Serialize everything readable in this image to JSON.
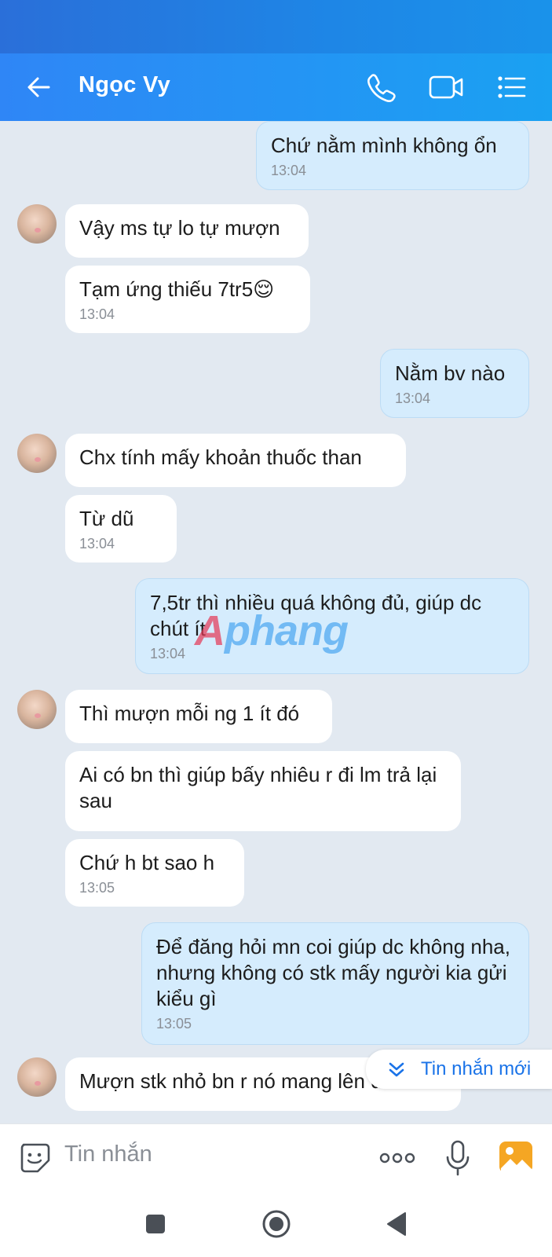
{
  "header": {
    "title": "Ngọc Vy",
    "back_icon": "arrow-left-icon",
    "call_icon": "phone-icon",
    "video_icon": "video-camera-icon",
    "menu_icon": "list-menu-icon"
  },
  "messages": [
    {
      "direction": "out",
      "text": "Chứ nằm mình không ổn",
      "time": "13:04"
    },
    {
      "direction": "in",
      "text": "Vậy ms tự lo tự mượn",
      "time": ""
    },
    {
      "direction": "in",
      "text": "Tạm ứng thiếu 7tr5😌",
      "time": "13:04"
    },
    {
      "direction": "out",
      "text": "Nằm bv nào",
      "time": "13:04"
    },
    {
      "direction": "in",
      "text": "Chx tính mấy khoản thuốc than",
      "time": ""
    },
    {
      "direction": "in",
      "text": "Từ dũ",
      "time": "13:04"
    },
    {
      "direction": "out",
      "text": "7,5tr thì nhiều quá không đủ, giúp dc chút ít",
      "time": "13:04"
    },
    {
      "direction": "in",
      "text": "Thì mượn mỗi ng 1 ít đó",
      "time": ""
    },
    {
      "direction": "in",
      "text": "Ai có bn thì giúp bấy nhiêu r đi lm trả lại sau",
      "time": ""
    },
    {
      "direction": "in",
      "text": "Chứ h bt sao h",
      "time": "13:05"
    },
    {
      "direction": "out",
      "text": "Để đăng hỏi mn coi giúp dc không nha, nhưng không có stk mấy người kia gửi kiểu gì",
      "time": "13:05"
    },
    {
      "direction": "in",
      "text": "Mượn stk nhỏ bn r nó mang lên dùm",
      "time": ""
    }
  ],
  "new_message_button": {
    "label": "Tin nhắn mới",
    "icon": "chevron-double-down-icon"
  },
  "watermark": {
    "part1": "A",
    "part2": "phang"
  },
  "input_bar": {
    "placeholder": "Tin nhắn",
    "emoji_icon": "sticker-smile-icon",
    "more_icon": "more-dots-icon",
    "mic_icon": "microphone-icon",
    "image_icon": "gallery-image-icon"
  },
  "nav_bar": {
    "recent_icon": "square-icon",
    "home_icon": "circle-home-icon",
    "back_icon": "triangle-back-icon"
  },
  "colors": {
    "header": "#1aa1f2",
    "outgoing_bubble": "#d5ecfd",
    "incoming_bubble": "#ffffff",
    "background": "#e2e9f1",
    "accent": "#1a73e8"
  }
}
